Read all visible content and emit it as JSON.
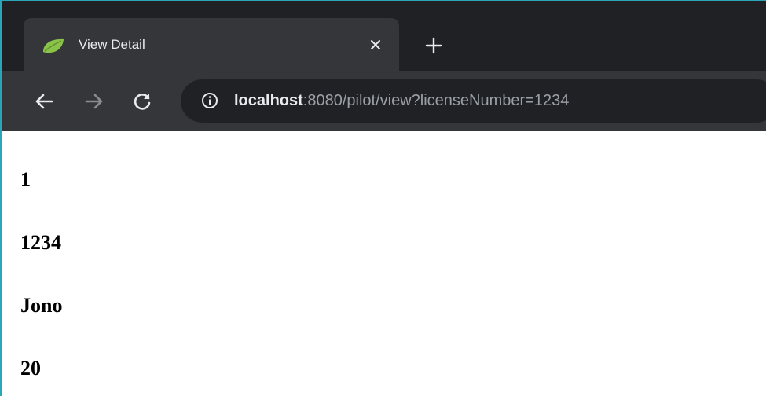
{
  "browser": {
    "tab": {
      "title": "View Detail",
      "favicon": "spring-leaf-icon"
    },
    "address_bar": {
      "host": "localhost",
      "path": ":8080/pilot/view?licenseNumber=1234"
    },
    "colors": {
      "tabstrip": "#202124",
      "toolbar": "#35363a",
      "leaf": "#8bc34a"
    }
  },
  "page": {
    "fields": [
      {
        "value": "1"
      },
      {
        "value": "1234"
      },
      {
        "value": "Jono"
      },
      {
        "value": "20"
      }
    ]
  }
}
